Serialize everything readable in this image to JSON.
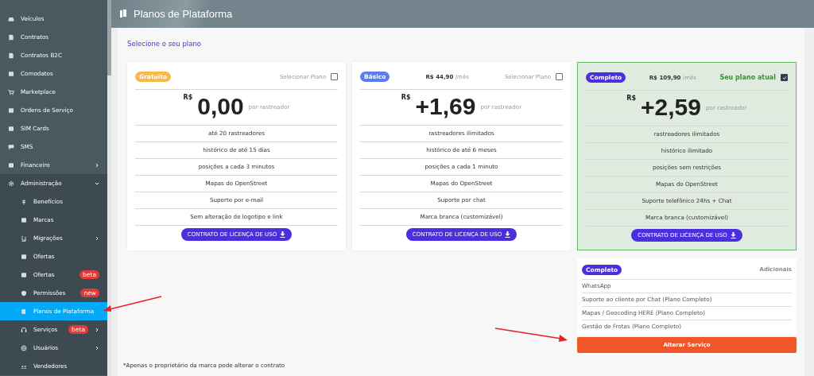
{
  "sidebar": {
    "items": [
      {
        "label": "Veículos"
      },
      {
        "label": "Contratos"
      },
      {
        "label": "Contratos B2C"
      },
      {
        "label": "Comodatos"
      },
      {
        "label": "Marketplace"
      },
      {
        "label": "Ordens de Serviço"
      },
      {
        "label": "SIM Cards"
      },
      {
        "label": "SMS"
      },
      {
        "label": "Financeiro",
        "expanded": false
      },
      {
        "label": "Administração",
        "expanded": true,
        "children": [
          {
            "label": "Benefícios",
            "selected": false
          },
          {
            "label": "Marcas",
            "selected": false
          },
          {
            "label": "Migrações",
            "selected": false,
            "expanded": false
          },
          {
            "label": "Ofertas",
            "selected": false
          },
          {
            "label": "Ofertas",
            "selected": false,
            "badge": "beta"
          },
          {
            "label": "Permissões",
            "selected": false,
            "badge": "new"
          },
          {
            "label": "Planos de Plataforma",
            "selected": true
          },
          {
            "label": "Serviços",
            "selected": false,
            "badge": "beta",
            "expanded": false
          },
          {
            "label": "Usuários",
            "selected": false,
            "expanded": false
          },
          {
            "label": "Vendedores",
            "selected": false
          }
        ]
      }
    ]
  },
  "header": {
    "title": "Planos de Plataforma"
  },
  "section_title": "Selecione o seu plano",
  "plans": [
    {
      "badge": "Gratuito",
      "color": "#f9b94a",
      "select_label": "Selecionar Plano",
      "checked": false,
      "current": false,
      "currency": "R$",
      "price": "0,00",
      "unit": "por rastreador",
      "features": [
        "até 20 rastreadores",
        "histórico de até 15 dias",
        "posições a cada 3 minutos",
        "Mapas do OpenStreet",
        "Suporte por e-mail",
        "Sem alteração de logotipo e link"
      ],
      "button": "CONTRATO DE LICENÇA DE USO"
    },
    {
      "badge": "Básico",
      "color": "#5b7cf0",
      "monthly": "R$ 44,90",
      "monthly_unit": "/mês",
      "select_label": "Selecionar Plano",
      "checked": false,
      "current": false,
      "currency": "R$",
      "price": "+1,69",
      "unit": "por rastreador",
      "features": [
        "rastreadores ilimitados",
        "histórico de até 6 meses",
        "posições a cada 1 minuto",
        "Mapas do OpenStreet",
        "Suporte por chat",
        "Marca branca (customizável)"
      ],
      "button": "CONTRATO DE LICENÇA DE USO"
    },
    {
      "badge": "Completo",
      "color": "#4a2fe0",
      "monthly": "R$ 109,90",
      "monthly_unit": "/mês",
      "select_label": "Seu plano atual",
      "checked": true,
      "current": true,
      "currency": "R$",
      "price": "+2,59",
      "unit": "por rastreador",
      "features": [
        "rastreadores ilimitados",
        "histórico ilimitado",
        "posições sem restrições",
        "Mapas do OpenStreet",
        "Suporte telefônico 24hs + Chat",
        "Marca branca (customizável)"
      ],
      "button": "CONTRATO DE LICENÇA DE USO"
    }
  ],
  "additions": {
    "badge": "Completo",
    "title": "Adicionais",
    "items": [
      "WhatsApp",
      "Suporte ao cliente por Chat (Plano Completo)",
      "Mapas / Geocoding HERE (Plano Completo)",
      "Gestão de Frotas (Plano Completo)"
    ],
    "button": "Alterar Serviço"
  },
  "footnote": "*Apenas o proprietário da marca pode alterar o contrato"
}
